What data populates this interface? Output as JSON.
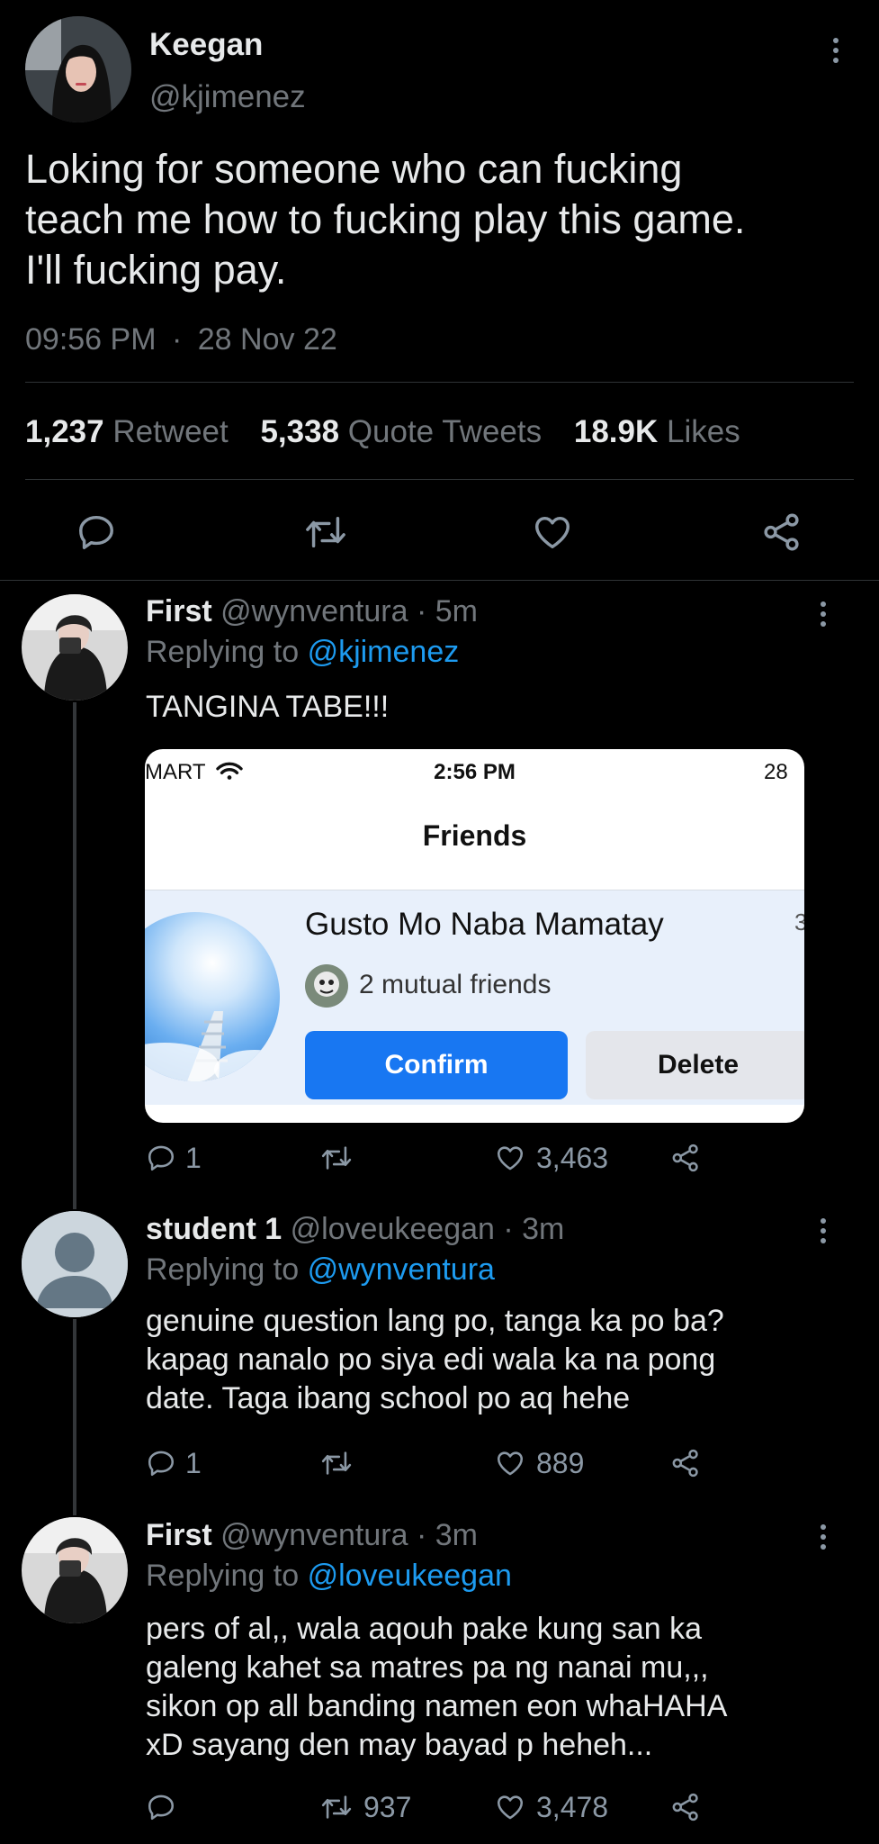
{
  "colors": {
    "background": "#000000",
    "text": "#e7e9ea",
    "muted": "#71767b",
    "link": "#1d9bf0",
    "confirm": "#1877f2"
  },
  "main_tweet": {
    "display_name": "Keegan",
    "handle": "@kjimenez",
    "text_lines": [
      "Loking for someone who can fucking",
      "teach me how to fucking play this game.",
      "I'll fucking pay."
    ],
    "time": "09:56 PM",
    "separator": "·",
    "date": "28 Nov 22",
    "retweet_count": "1,237",
    "retweet_label": "Retweet",
    "quote_count": "5,338",
    "quote_label": "Quote Tweets",
    "likes_count": "18.9K",
    "likes_label": "Likes",
    "icons": [
      "reply-icon",
      "retweet-icon",
      "like-icon",
      "share-icon"
    ]
  },
  "replies": [
    {
      "display_name": "First",
      "handle": "@wynventura",
      "time": "· 5m",
      "replying_label": "Replying to",
      "replying_to": "@kjimenez",
      "text_lines": [
        "TANGINA TABE!!!"
      ],
      "reply_count": "1",
      "retweet_count": "",
      "like_count": "3,463"
    },
    {
      "display_name": "student 1",
      "handle": "@loveukeegan",
      "time": "· 3m",
      "replying_label": "Replying to",
      "replying_to": "@wynventura",
      "text_lines": [
        "genuine question lang po, tanga ka po ba?",
        "kapag nanalo po siya edi wala ka na pong",
        "date. Taga ibang school po aq hehe"
      ],
      "reply_count": "1",
      "retweet_count": "",
      "like_count": "889"
    },
    {
      "display_name": "First",
      "handle": "@wynventura",
      "time": "· 3m",
      "replying_label": "Replying to",
      "replying_to": "@loveukeegan",
      "text_lines": [
        "pers of al,, wala aqouh pake kung san ka",
        "galeng kahet sa matres pa ng nanai mu,,,",
        "sikon op all banding namen eon whaHAHA",
        "xD sayang den may bayad p heheh..."
      ],
      "reply_count": "",
      "retweet_count": "937",
      "like_count": "3,478"
    }
  ],
  "embedded_screenshot": {
    "carrier": "MART",
    "time": "2:56 PM",
    "battery": "28",
    "title": "Friends",
    "name": "Gusto Mo Naba Mamatay",
    "side_num": "3",
    "mutual": "2 mutual friends",
    "confirm_label": "Confirm",
    "delete_label": "Delete"
  }
}
